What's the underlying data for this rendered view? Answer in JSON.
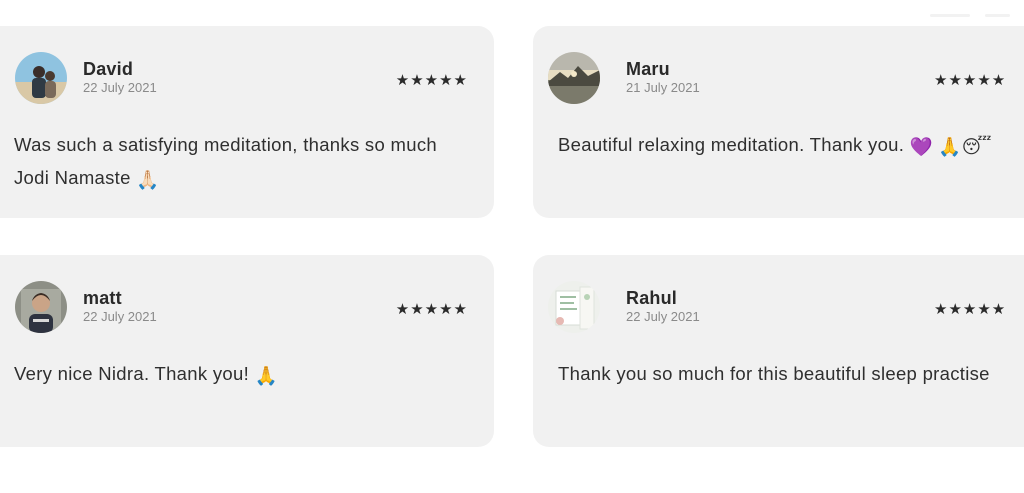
{
  "reviews": [
    {
      "name": "David",
      "date": "22 July 2021",
      "stars": "★★★★★",
      "text": "Was such a satisfying meditation, thanks so much Jodi Namaste",
      "emoji": "🙏🏻"
    },
    {
      "name": "Maru",
      "date": "21 July 2021",
      "stars": "★★★★★",
      "text": "Beautiful relaxing meditation. Thank you.",
      "emoji": "💜 🙏😴"
    },
    {
      "name": "matt",
      "date": "22 July 2021",
      "stars": "★★★★★",
      "text": "Very nice Nidra. Thank you!",
      "emoji": "🙏"
    },
    {
      "name": "Rahul",
      "date": "22 July 2021",
      "stars": "★★★★★",
      "text": "Thank you so much for this beautiful sleep practise",
      "emoji": ""
    }
  ],
  "colors": {
    "card_bg": "#f1f1f1",
    "text": "#2f2f2f",
    "date": "#8a8a8a"
  }
}
